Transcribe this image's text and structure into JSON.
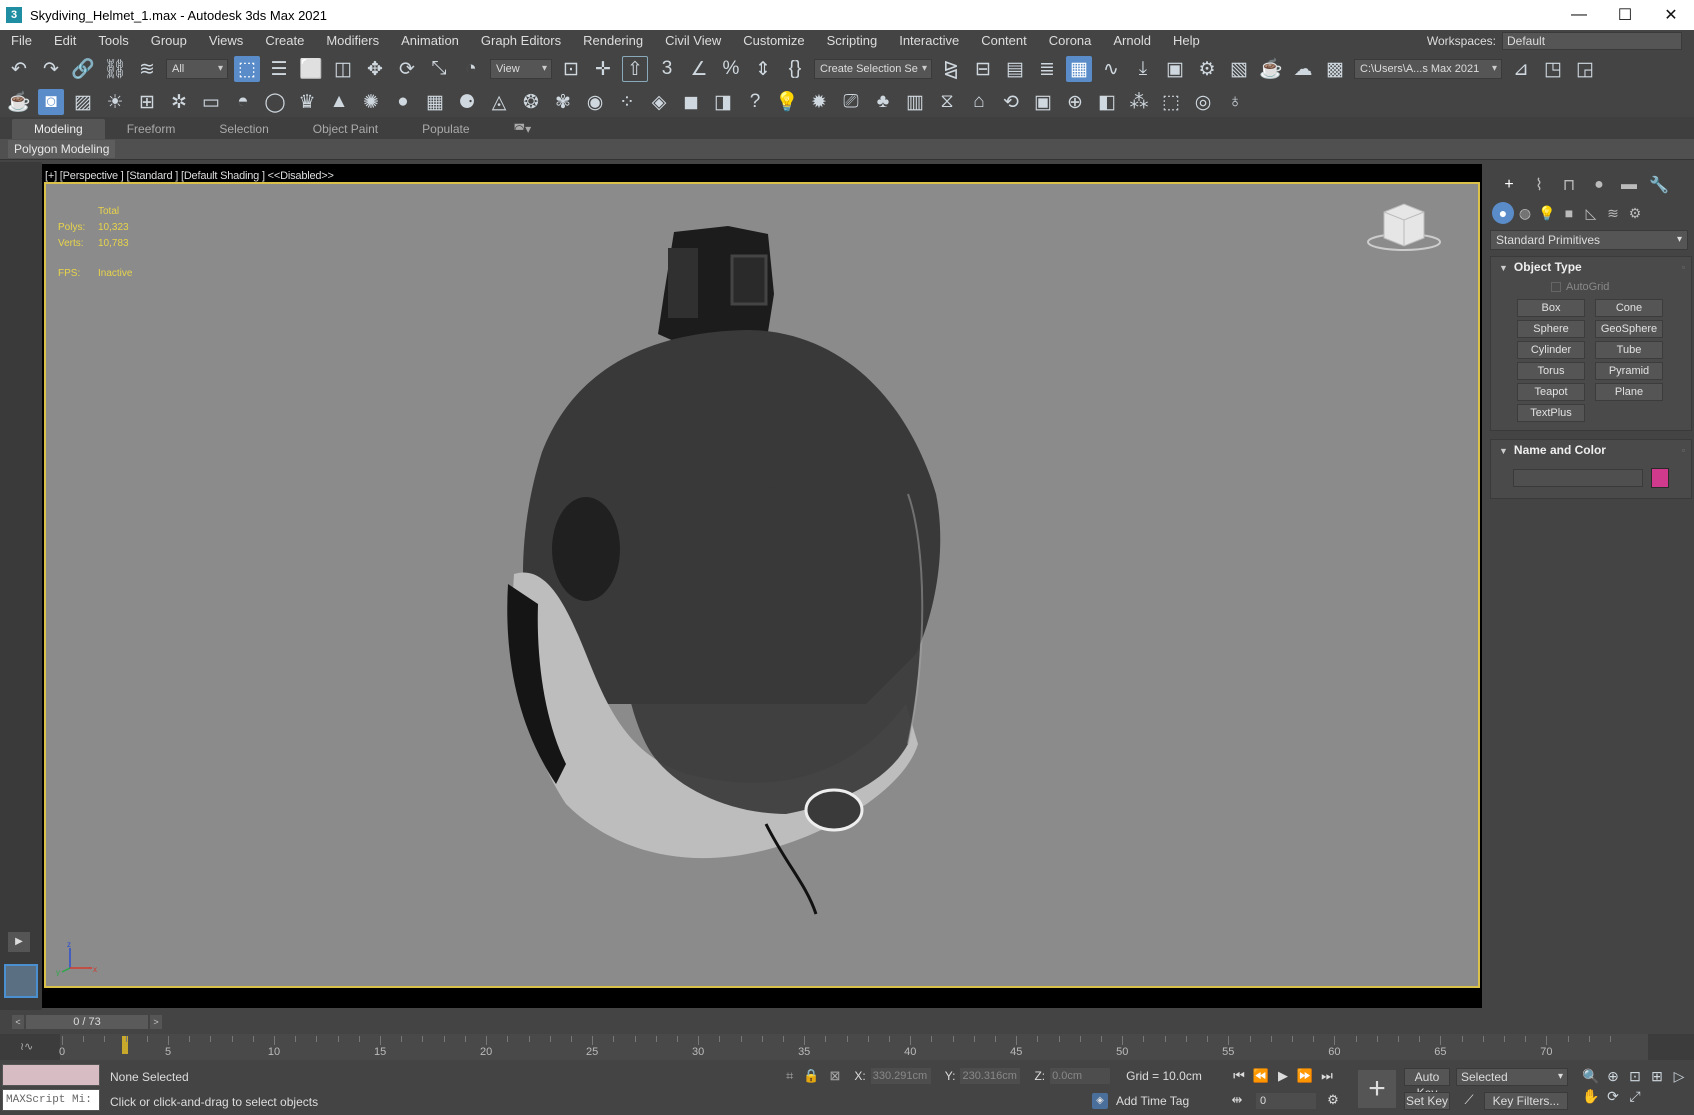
{
  "window": {
    "title": "Skydiving_Helmet_1.max - Autodesk 3ds Max 2021",
    "app_icon": "3",
    "minimize": "—",
    "maximize": "☐",
    "close": "✕"
  },
  "menu": [
    "File",
    "Edit",
    "Tools",
    "Group",
    "Views",
    "Create",
    "Modifiers",
    "Animation",
    "Graph Editors",
    "Rendering",
    "Civil View",
    "Customize",
    "Scripting",
    "Interactive",
    "Content",
    "Corona",
    "Arnold",
    "Help"
  ],
  "workspace": {
    "label": "Workspaces:",
    "value": "Default"
  },
  "toolbar": {
    "filter_value": "All",
    "refcoord_value": "View",
    "selection_set_placeholder": "Create Selection Se",
    "project_path": "C:\\Users\\A...s Max 2021"
  },
  "ribbon": {
    "tabs": [
      "Modeling",
      "Freeform",
      "Selection",
      "Object Paint",
      "Populate"
    ],
    "active_tab": "Modeling",
    "panel_label": "Polygon Modeling"
  },
  "viewport": {
    "label": "[+] [Perspective ] [Standard ] [Default Shading ]  <<Disabled>>",
    "stats_header": "Total",
    "polys_label": "Polys:",
    "polys_value": "10,323",
    "verts_label": "Verts:",
    "verts_value": "10,783",
    "fps_label": "FPS:",
    "fps_value": "Inactive",
    "background": "#8b8b8b",
    "border_color": "#d9c14a"
  },
  "command_panel": {
    "category": "Standard Primitives",
    "object_type_title": "Object Type",
    "autogrid_label": "AutoGrid",
    "buttons": [
      "Box",
      "Cone",
      "Sphere",
      "GeoSphere",
      "Cylinder",
      "Tube",
      "Torus",
      "Pyramid",
      "Teapot",
      "Plane",
      "TextPlus"
    ],
    "name_color_title": "Name and Color",
    "name_value": "",
    "object_color": "#cf3a8d"
  },
  "timeline": {
    "frame_display": "0 / 73",
    "prev": "<",
    "next": ">",
    "ticks": [
      "0",
      "5",
      "10",
      "15",
      "20",
      "25",
      "30",
      "35",
      "40",
      "45",
      "50",
      "55",
      "60",
      "65",
      "70"
    ]
  },
  "status": {
    "maxscript_placeholder": "MAXScript Mi:",
    "selection_status": "None Selected",
    "prompt": "Click or click-and-drag to select objects",
    "x_label": "X:",
    "x_value": "330.291cm",
    "y_label": "Y:",
    "y_value": "230.316cm",
    "z_label": "Z:",
    "z_value": "0.0cm",
    "grid": "Grid = 10.0cm",
    "add_time_tag": "Add Time Tag",
    "auto_key": "Auto Key",
    "set_key": "Set Key",
    "key_mode_value": "Selected",
    "key_filters": "Key Filters...",
    "current_frame": "0"
  }
}
